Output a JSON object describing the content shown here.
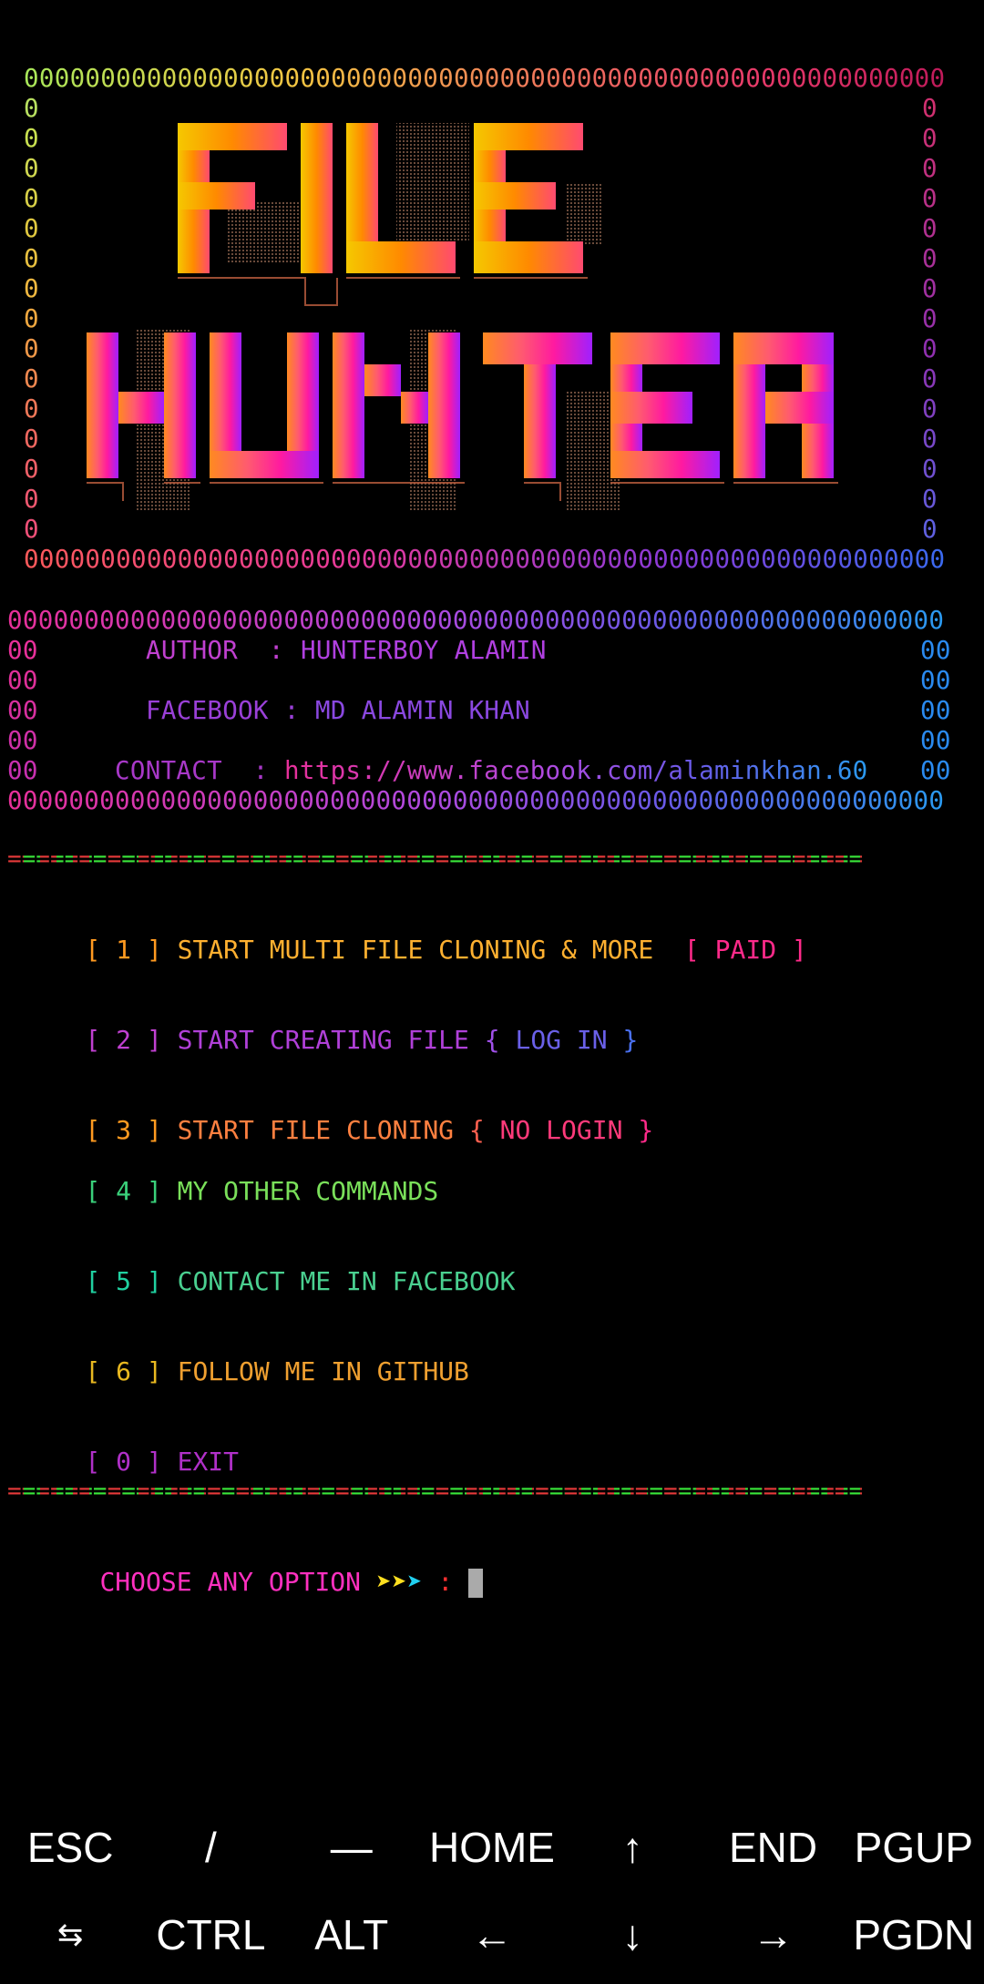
{
  "banner": {
    "border_top": "000000000000000000000000000000000000000000000000000000000000",
    "border_bottom": "000000000000000000000000000000000000000000000000000000000000",
    "side_char": "0",
    "logo_line1": "FILE",
    "logo_line2": "HUNTER"
  },
  "info": {
    "border": "0000000000000000000000000000000000000000000000000000000000000",
    "side": "00",
    "author_label": "AUTHOR  : ",
    "author_value": "HUNTERBOY ALAMIN",
    "facebook_label": "FACEBOOK : ",
    "facebook_value": "MD ALAMIN KHAN",
    "contact_label": "CONTACT  : ",
    "contact_value": "https://www.facebook.com/alaminkhan.60"
  },
  "separator": "============================================================",
  "menu": {
    "opt1_num": "[ 1 ]",
    "opt1_text": "START MULTI FILE CLONING & MORE",
    "opt1_tag": "[ PAID ]",
    "opt2_num": "[ 2 ]",
    "opt2_text": "START CREATING FILE",
    "opt2_brace_open": "{",
    "opt2_tag": "LOG IN",
    "opt2_brace_close": "}",
    "opt3_num": "[ 3 ]",
    "opt3_text": "START FILE CLONING",
    "opt3_brace_open": "{",
    "opt3_tag": "NO LOGIN",
    "opt3_brace_close": "}",
    "opt4_num": "[ 4 ]",
    "opt4_text": "MY OTHER COMMANDS",
    "opt5_num": "[ 5 ]",
    "opt5_text": "CONTACT ME IN FACEBOOK",
    "opt6_num": "[ 6 ]",
    "opt6_text": "FOLLOW ME IN GITHUB",
    "opt0_num": "[ 0 ]",
    "opt0_text": "EXIT"
  },
  "prompt": {
    "text": "CHOOSE ANY OPTION",
    "arrows": "➤➤➤",
    "colon": ":"
  },
  "extra_keys": {
    "row1": [
      "ESC",
      "/",
      "—",
      "HOME",
      "↑",
      "END",
      "PGUP"
    ],
    "row2": [
      "⇆",
      "CTRL",
      "ALT",
      "←",
      "↓",
      "→",
      "PGDN"
    ]
  }
}
